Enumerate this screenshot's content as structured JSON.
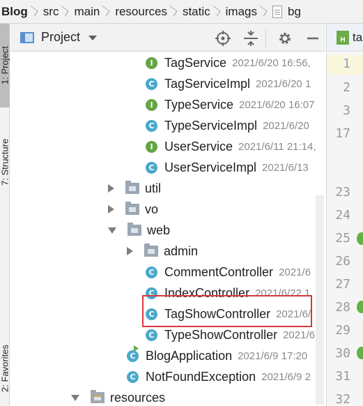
{
  "breadcrumb": {
    "items": [
      "Blog",
      "src",
      "main",
      "resources",
      "static",
      "imags",
      "bg"
    ]
  },
  "left_strip": {
    "tabs": [
      "1: Project",
      "7: Structure",
      "2: Favorites"
    ]
  },
  "panel": {
    "title": "Project",
    "tools": [
      "crosshair-icon",
      "collapse-all-icon",
      "gear-icon",
      "hide-icon"
    ]
  },
  "tree": {
    "rows": [
      {
        "label": "TagService",
        "meta": "2021/6/20 16:56,",
        "kind": "interface"
      },
      {
        "label": "TagServiceImpl",
        "meta": "2021/6/20 1",
        "kind": "class"
      },
      {
        "label": "TypeService",
        "meta": "2021/6/20 16:07",
        "kind": "interface"
      },
      {
        "label": "TypeServiceImpl",
        "meta": "2021/6/20",
        "kind": "class"
      },
      {
        "label": "UserService",
        "meta": "2021/6/11 21:14,",
        "kind": "interface"
      },
      {
        "label": "UserServiceImpl",
        "meta": "2021/6/13",
        "kind": "class"
      },
      {
        "label": "util",
        "kind": "folder-collapsed"
      },
      {
        "label": "vo",
        "kind": "folder-collapsed"
      },
      {
        "label": "web",
        "kind": "folder-expanded"
      },
      {
        "label": "admin",
        "kind": "folder-collapsed"
      },
      {
        "label": "CommentController",
        "meta": "2021/6",
        "kind": "class"
      },
      {
        "label": "IndexController",
        "meta": "2021/6/22 1",
        "kind": "class"
      },
      {
        "label": "TagShowController",
        "meta": "2021/6/",
        "kind": "class"
      },
      {
        "label": "TypeShowController",
        "meta": "2021/6",
        "kind": "class"
      },
      {
        "label": "BlogApplication",
        "meta": "2021/6/9 17:20",
        "kind": "spring-class"
      },
      {
        "label": "NotFoundException",
        "meta": "2021/6/9 2",
        "kind": "class"
      },
      {
        "label": "resources",
        "kind": "resources-folder"
      }
    ]
  },
  "editor": {
    "tab_label": "ta",
    "tab_icon_text": "H",
    "line_numbers": [
      "1",
      "2",
      "3",
      "17",
      "23",
      "24",
      "25",
      "26",
      "27",
      "28",
      "29",
      "30",
      "31",
      "32"
    ]
  },
  "icon_letters": {
    "class": "C",
    "interface": "I"
  },
  "colors": {
    "class_icon": "#4aa9c9",
    "interface_icon": "#62a644",
    "highlight_border": "#d9363e",
    "gutter_marker": "#62b343"
  }
}
